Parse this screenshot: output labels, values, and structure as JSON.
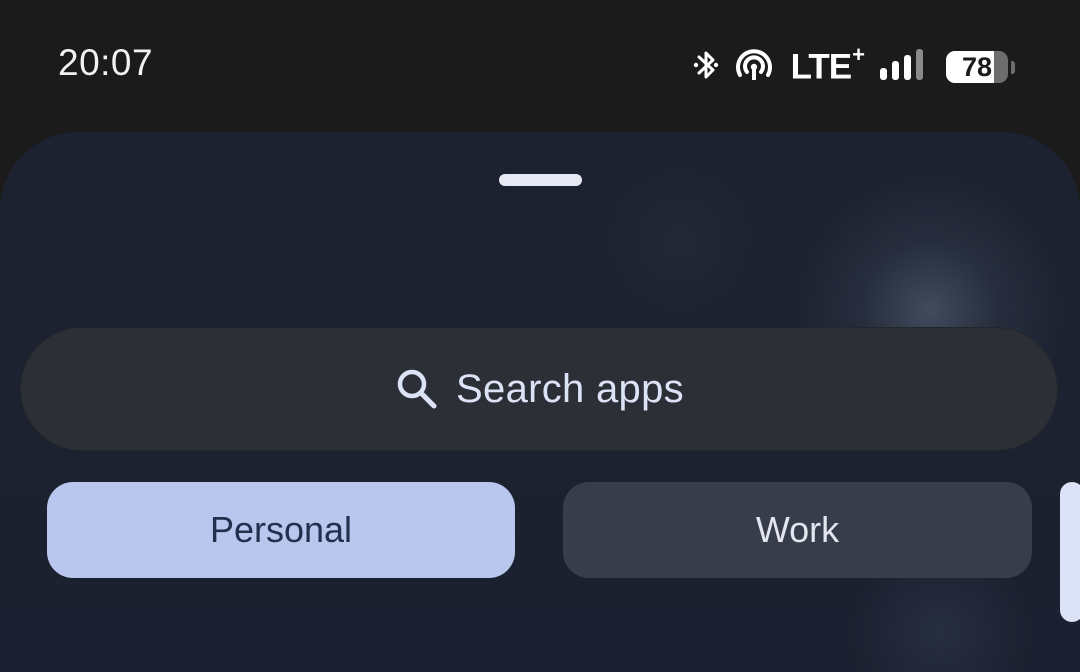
{
  "status_bar": {
    "time": "20:07",
    "network": "LTE",
    "network_plus": "+",
    "battery_level": "78",
    "battery_fraction": 0.78,
    "icons": [
      "bluetooth-icon",
      "hotspot-icon",
      "lte-icon",
      "signal-icon",
      "battery-icon"
    ]
  },
  "app_drawer": {
    "search": {
      "label": "Search apps",
      "icon": "search-icon"
    },
    "tabs": [
      {
        "label": "Personal",
        "selected": true
      },
      {
        "label": "Work",
        "selected": false
      }
    ]
  },
  "colors": {
    "accent": "#b9c6ed",
    "sheet_bg": "#1d2230",
    "search_bg": "#2d2f36",
    "tab_inactive_bg": "#383d4c"
  }
}
